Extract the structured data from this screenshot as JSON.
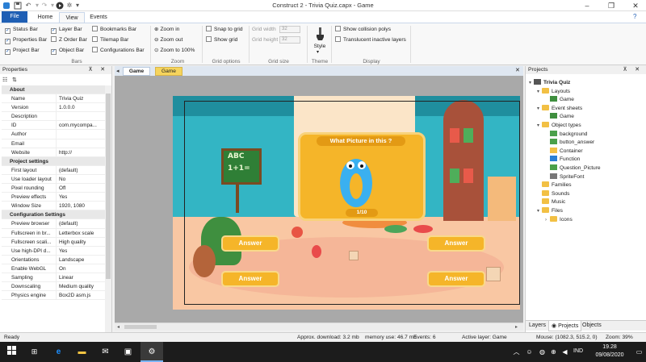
{
  "window": {
    "title": "Construct 2 - Trivia Quiz.capx - Game",
    "controls": [
      "minimize-icon",
      "restore-icon",
      "close-icon"
    ]
  },
  "ribbon": {
    "tabs": [
      "File",
      "Home",
      "View",
      "Events"
    ],
    "active_tab": "View",
    "bars": {
      "items": [
        "Status Bar",
        "Properties Bar",
        "Project Bar",
        "Layer Bar",
        "Z Order Bar",
        "Object Bar",
        "Bookmarks Bar",
        "Tilemap Bar",
        "Configurations Bar"
      ],
      "checked": [
        true,
        true,
        true,
        true,
        false,
        true,
        false,
        false,
        false
      ],
      "label": "Bars"
    },
    "zoom": {
      "items": [
        "Zoom in",
        "Zoom out",
        "Zoom to 100%"
      ],
      "label": "Zoom"
    },
    "grid_options": {
      "items": [
        "Snap to grid",
        "Show grid"
      ],
      "label": "Grid options"
    },
    "grid_size": {
      "width_label": "Grid width",
      "width_value": "32",
      "height_label": "Grid height",
      "height_value": "32",
      "label": "Grid size"
    },
    "theme": {
      "button": "Style",
      "label": "Theme"
    },
    "display": {
      "items": [
        "Show collision polys",
        "Translucent inactive layers"
      ],
      "label": "Display"
    }
  },
  "properties": {
    "title": "Properties",
    "rows": [
      {
        "section": "About"
      },
      {
        "k": "Name",
        "v": "Trivia Quiz"
      },
      {
        "k": "Version",
        "v": "1.0.0.0"
      },
      {
        "k": "Description",
        "v": ""
      },
      {
        "k": "ID",
        "v": "com.mycompa..."
      },
      {
        "k": "Author",
        "v": ""
      },
      {
        "k": "Email",
        "v": ""
      },
      {
        "k": "Website",
        "v": "http://"
      },
      {
        "section": "Project settings"
      },
      {
        "k": "First layout",
        "v": "(default)"
      },
      {
        "k": "Use loader layout",
        "v": "No"
      },
      {
        "k": "Pixel rounding",
        "v": "Off"
      },
      {
        "k": "Preview effects",
        "v": "Yes"
      },
      {
        "k": "Window Size",
        "v": "1920, 1080"
      },
      {
        "section": "Configuration Settings"
      },
      {
        "k": "Preview browser",
        "v": "(default)"
      },
      {
        "k": "Fullscreen in br...",
        "v": "Letterbox scale"
      },
      {
        "k": "Fullscreen scali...",
        "v": "High quality"
      },
      {
        "k": "Use high-DPI d...",
        "v": "Yes"
      },
      {
        "k": "Orientations",
        "v": "Landscape"
      },
      {
        "k": "Enable WebGL",
        "v": "On"
      },
      {
        "k": "Sampling",
        "v": "Linear"
      },
      {
        "k": "Downscaling",
        "v": "Medium quality"
      },
      {
        "k": "Physics engine",
        "v": "Box2D asm.js"
      }
    ]
  },
  "document_tabs": [
    "Game",
    "Game"
  ],
  "game": {
    "question_title": "What Picture in this ?",
    "counter": "1/10",
    "answers": [
      "Answer",
      "Answer",
      "Answer",
      "Answer"
    ],
    "board_line1": "ABC",
    "board_line2": "1+1="
  },
  "projects": {
    "title": "Projects",
    "tree": [
      {
        "label": "Trivia Quiz",
        "icon": "project-icon"
      },
      {
        "label": "Layouts",
        "icon": "folder-icon"
      },
      {
        "label": "Game",
        "icon": "layout-icon"
      },
      {
        "label": "Event sheets",
        "icon": "folder-icon"
      },
      {
        "label": "Game",
        "icon": "event-sheet-icon"
      },
      {
        "label": "Object types",
        "icon": "folder-icon"
      },
      {
        "label": "background",
        "icon": "sprite-icon"
      },
      {
        "label": "button_answer",
        "icon": "sprite-icon"
      },
      {
        "label": "Container",
        "icon": "container-icon"
      },
      {
        "label": "Function",
        "icon": "function-icon"
      },
      {
        "label": "Question_Picture",
        "icon": "sprite-icon"
      },
      {
        "label": "SpriteFont",
        "icon": "spritefont-icon"
      },
      {
        "label": "Families",
        "icon": "folder-icon"
      },
      {
        "label": "Sounds",
        "icon": "folder-icon"
      },
      {
        "label": "Music",
        "icon": "folder-icon"
      },
      {
        "label": "Files",
        "icon": "folder-icon"
      },
      {
        "label": "Icons",
        "icon": "folder-icon"
      }
    ],
    "bottom_tabs": [
      "Layers",
      "Projects",
      "Objects"
    ]
  },
  "status": {
    "left": "Ready",
    "download": "Approx. download: 3.2 mb",
    "memory": "memory use: 46.7 mb",
    "events": "Events: 6",
    "layer": "Active layer: Game",
    "mouse": "Mouse: (1082.3, 515.2, 0)",
    "zoom": "Zoom: 39%"
  },
  "taskbar": {
    "time": "19.28",
    "date": "09/08/2020",
    "lang": "IND"
  },
  "colors": {
    "file_tab": "#1f5fb4",
    "panel_bg": "#ffffff",
    "canvas_bg": "#a9a9a9",
    "taskbar": "#1c1c1c",
    "card": "#f5b529"
  }
}
